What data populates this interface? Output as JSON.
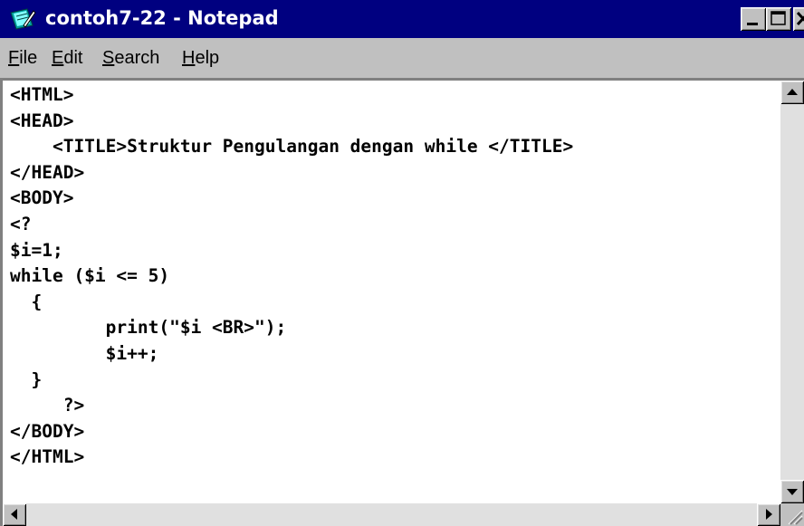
{
  "window": {
    "title": "contoh7-22 - Notepad",
    "title_bar_color": "#000080"
  },
  "menu": {
    "items": [
      {
        "label_first": "F",
        "label_rest": "ile"
      },
      {
        "label_first": "E",
        "label_rest": "dit"
      },
      {
        "label_first": "S",
        "label_rest": "earch"
      },
      {
        "label_first": "H",
        "label_rest": "elp"
      }
    ]
  },
  "editor": {
    "content": "<HTML>\n<HEAD>\n    <TITLE>Struktur Pengulangan dengan while </TITLE>\n</HEAD>\n<BODY>\n<?\n$i=1;\nwhile ($i <= 5)\n  {\n         print(\"$i <BR>\");\n         $i++;\n  }\n     ?>\n</BODY>\n</HTML>"
  },
  "icons": {
    "app": "notepad-icon",
    "minimize": "minimize-icon",
    "maximize": "maximize-icon",
    "close": "close-icon",
    "scroll_up": "arrow-up-icon",
    "scroll_down": "arrow-down-icon",
    "scroll_left": "arrow-left-icon",
    "scroll_right": "arrow-right-icon"
  }
}
